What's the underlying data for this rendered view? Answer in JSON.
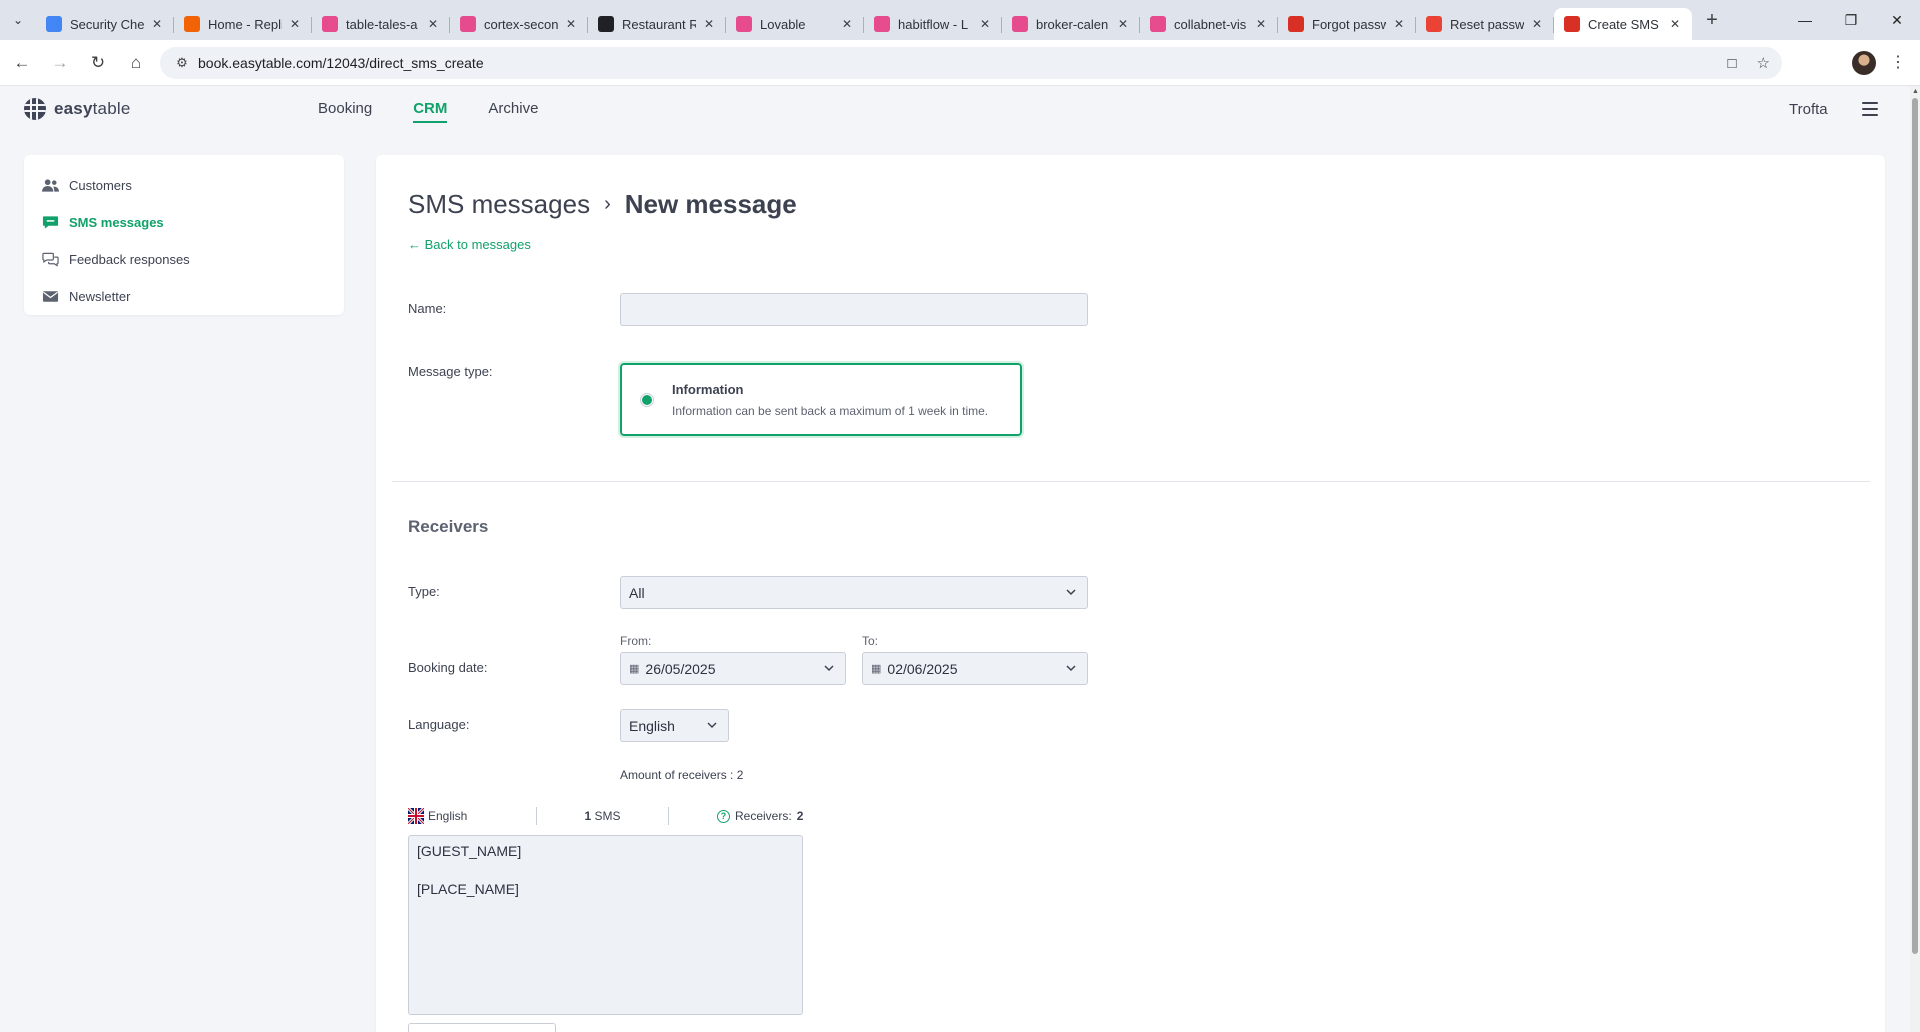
{
  "browser": {
    "tabs": [
      {
        "label": "Security Check",
        "color": "#4285f4"
      },
      {
        "label": "Home - Replit",
        "color": "#f26207"
      },
      {
        "label": "table-tales-a",
        "color": "#e64b8d"
      },
      {
        "label": "cortex-secon",
        "color": "#e64b8d"
      },
      {
        "label": "Restaurant R",
        "color": "#202124"
      },
      {
        "label": "Lovable",
        "color": "#e64b8d"
      },
      {
        "label": "habitflow - L",
        "color": "#e64b8d"
      },
      {
        "label": "broker-calen",
        "color": "#e64b8d"
      },
      {
        "label": "collabnet-vis",
        "color": "#e64b8d"
      },
      {
        "label": "Forgot passw",
        "color": "#d93025"
      },
      {
        "label": "Reset passw",
        "color": "#ea4335"
      },
      {
        "label": "Create SMS",
        "color": "#d93025",
        "active": true
      }
    ],
    "url": "book.easytable.com/12043/direct_sms_create"
  },
  "header": {
    "logo_bold": "easy",
    "logo_light": "table",
    "nav": [
      "Booking",
      "CRM",
      "Archive"
    ],
    "active_nav": "CRM",
    "account": "Trofta"
  },
  "sidebar": {
    "items": [
      {
        "label": "Customers",
        "icon": "users-icon"
      },
      {
        "label": "SMS messages",
        "icon": "chat-icon",
        "active": true
      },
      {
        "label": "Feedback responses",
        "icon": "comments-icon"
      },
      {
        "label": "Newsletter",
        "icon": "envelope-icon"
      }
    ]
  },
  "main": {
    "breadcrumb_parent": "SMS messages",
    "breadcrumb_current": "New message",
    "back_link": "Back to messages",
    "name_label": "Name:",
    "name_value": "",
    "message_type_label": "Message type:",
    "message_type": {
      "title": "Information",
      "description": "Information can be sent back a maximum of 1 week in time."
    },
    "receivers": {
      "title": "Receivers",
      "type_label": "Type:",
      "type_value": "All",
      "booking_date_label": "Booking date:",
      "from_label": "From:",
      "from_value": "26/05/2025",
      "to_label": "To:",
      "to_value": "02/06/2025",
      "language_label": "Language:",
      "language_value": "English",
      "amount_text": "Amount of receivers : 2"
    },
    "sms": {
      "language": "English",
      "sms_count": "1",
      "sms_unit": "SMS",
      "receivers_label": "Receivers:",
      "receivers_count": "2",
      "message": "[GUEST_NAME]\n\n[PLACE_NAME]"
    }
  },
  "colors": {
    "accent": "#11a16a",
    "text": "#3d4251",
    "input_bg": "#eef1f6"
  }
}
